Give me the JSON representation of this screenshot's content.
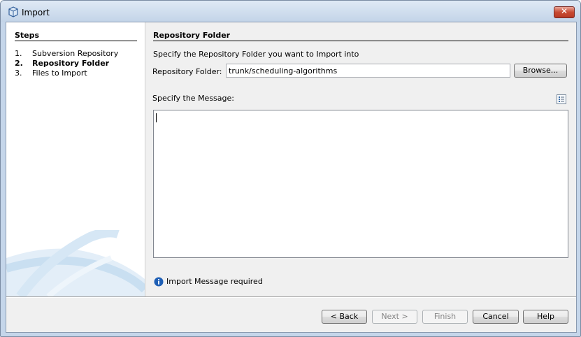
{
  "window": {
    "title": "Import",
    "close_glyph": "✕"
  },
  "steps": {
    "title": "Steps",
    "items": [
      {
        "number": "1.",
        "label": "Subversion Repository",
        "current": false
      },
      {
        "number": "2.",
        "label": "Repository Folder",
        "current": true
      },
      {
        "number": "3.",
        "label": "Files to Import",
        "current": false
      }
    ]
  },
  "content": {
    "title": "Repository Folder",
    "instruction": "Specify the Repository Folder you want to Import into",
    "folder_label": "Repository Folder:",
    "folder_value": "trunk/scheduling-algorithms",
    "browse_label": "Browse...",
    "message_label": "Specify the Message:",
    "message_value": "",
    "info_text": "Import Message required"
  },
  "buttons": {
    "back": "< Back",
    "next": "Next >",
    "finish": "Finish",
    "cancel": "Cancel",
    "help": "Help"
  },
  "icons": {
    "app": "netbeans-cube-icon",
    "template": "message-template-icon",
    "info": "info-icon"
  },
  "colors": {
    "titlebar": "#c5d6ea",
    "close_button": "#c84a32",
    "info": "#1f5fb5"
  }
}
